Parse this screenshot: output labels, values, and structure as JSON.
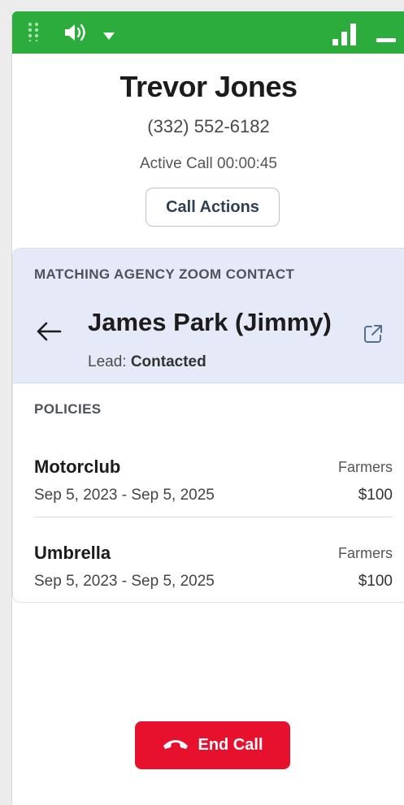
{
  "caller": {
    "name": "Trevor Jones",
    "phone": "(332) 552-6182",
    "status": "Active Call 00:00:45"
  },
  "actions": {
    "call_actions_label": "Call Actions",
    "end_call_label": "End Call"
  },
  "matching_contact": {
    "heading": "MATCHING AGENCY ZOOM CONTACT",
    "name": "James Park (Jimmy)",
    "lead_label": "Lead:",
    "lead_status": "Contacted"
  },
  "policies": {
    "heading": "POLICIES",
    "items": [
      {
        "name": "Motorclub",
        "dates": "Sep 5, 2023 - Sep 5, 2025",
        "carrier": "Farmers",
        "amount": "$100"
      },
      {
        "name": "Umbrella",
        "dates": "Sep 5, 2023 - Sep 5, 2025",
        "carrier": "Farmers",
        "amount": "$100"
      }
    ]
  },
  "icons": {
    "grip": "grip-dots-icon",
    "speaker": "speaker-icon",
    "dropdown": "chevron-down-icon",
    "signal": "signal-bars-icon",
    "minimize": "minimize-icon",
    "back": "back-arrow-icon",
    "external": "external-link-icon",
    "hangup": "phone-hangup-icon"
  },
  "colors": {
    "titlebar": "#2bac3c",
    "match_background": "#e5e9f8",
    "end_call": "#e8112d",
    "call_actions_text": "#2e4154"
  }
}
